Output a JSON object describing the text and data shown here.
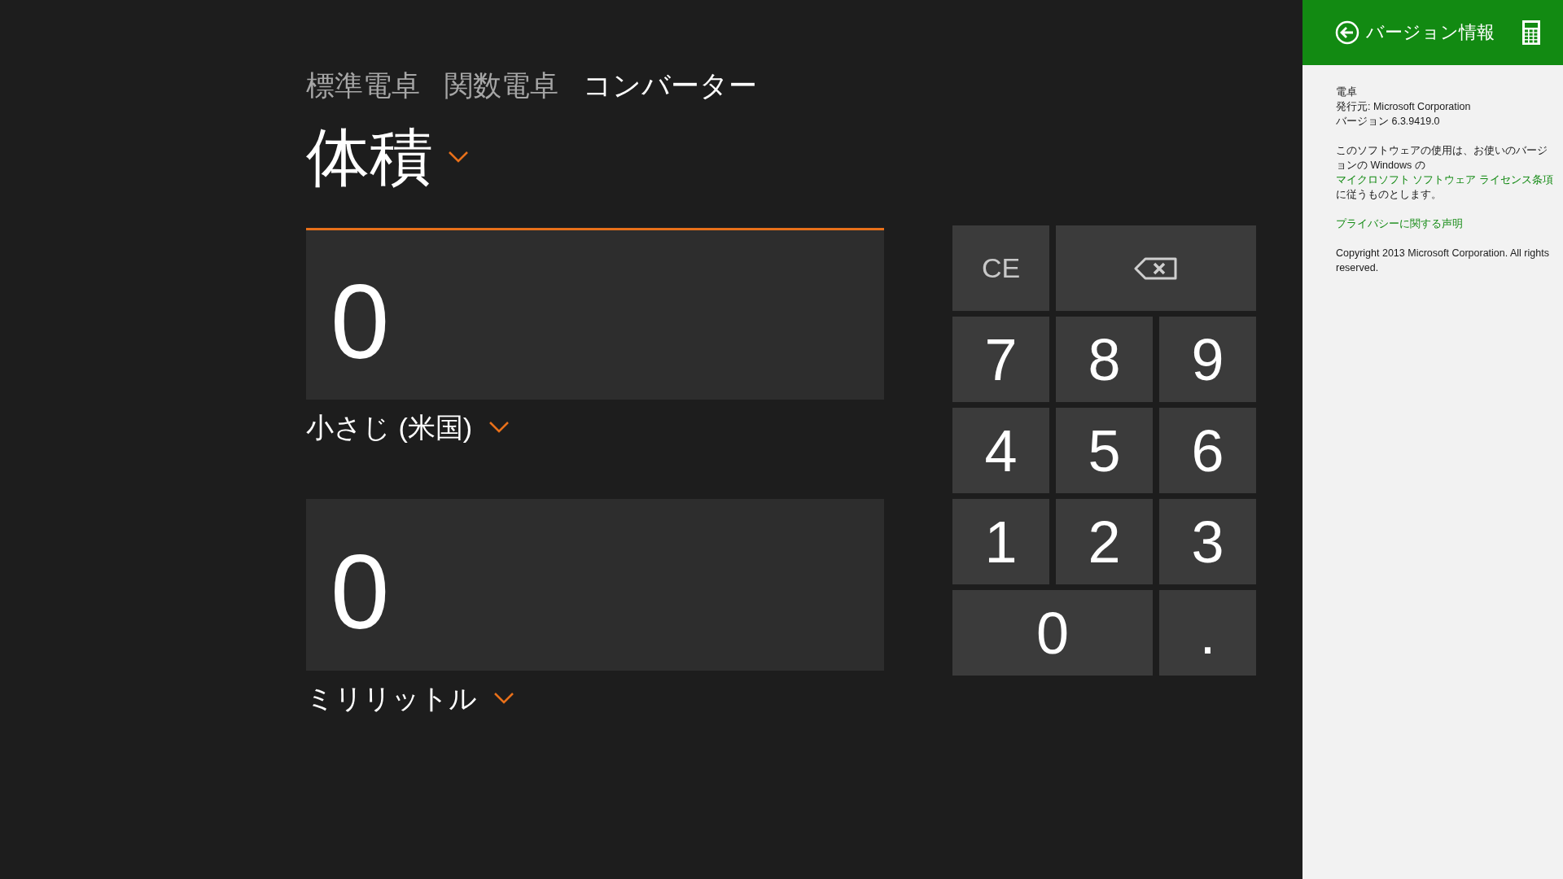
{
  "tabs": [
    {
      "label": "標準電卓",
      "selected": false
    },
    {
      "label": "関数電卓",
      "selected": false
    },
    {
      "label": "コンバーター",
      "selected": true
    }
  ],
  "category": {
    "label": "体積"
  },
  "converters": [
    {
      "value": "0",
      "unit": "小さじ (米国)",
      "focused": true
    },
    {
      "value": "0",
      "unit": "ミリリットル",
      "focused": false
    }
  ],
  "keypad": [
    {
      "kind": "text",
      "label": "CE",
      "wide": false
    },
    {
      "kind": "backspace",
      "wide": true
    },
    {
      "kind": "digit",
      "label": "7",
      "wide": false
    },
    {
      "kind": "digit",
      "label": "8",
      "wide": false
    },
    {
      "kind": "digit",
      "label": "9",
      "wide": false
    },
    {
      "kind": "digit",
      "label": "4",
      "wide": false
    },
    {
      "kind": "digit",
      "label": "5",
      "wide": false
    },
    {
      "kind": "digit",
      "label": "6",
      "wide": false
    },
    {
      "kind": "digit",
      "label": "1",
      "wide": false
    },
    {
      "kind": "digit",
      "label": "2",
      "wide": false
    },
    {
      "kind": "digit",
      "label": "3",
      "wide": false
    },
    {
      "kind": "digit",
      "label": "0",
      "wide": true
    },
    {
      "kind": "digit",
      "label": ".",
      "wide": false
    }
  ],
  "about_panel": {
    "title": "バージョン情報",
    "app_name": "電卓",
    "publisher": "発行元: Microsoft Corporation",
    "version": "バージョン 6.3.9419.0",
    "license": {
      "before": "このソフトウェアの使用は、お使いのバージョンの Windows の ",
      "link": "マイクロソフト ソフトウェア ライセンス条項",
      "after": " に従うものとします。"
    },
    "privacy_link": "プライバシーに関する声明",
    "copyright": "Copyright 2013 Microsoft Corporation. All rights reserved."
  }
}
